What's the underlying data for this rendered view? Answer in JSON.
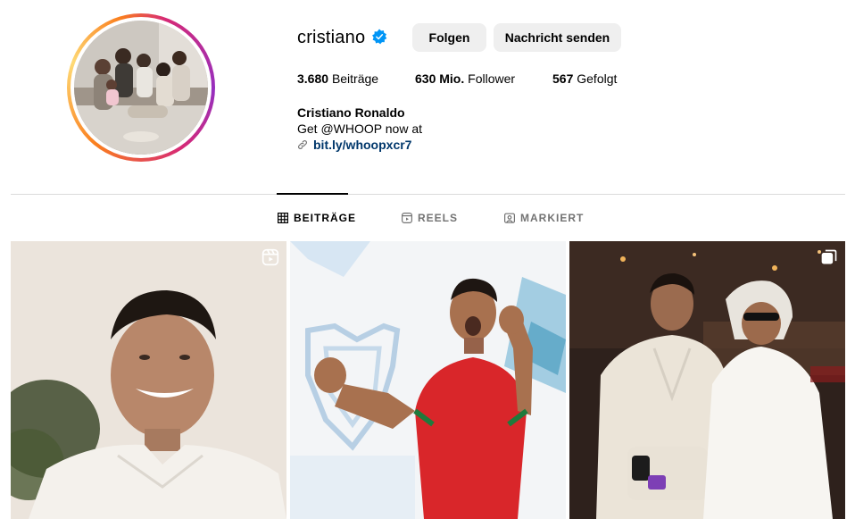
{
  "profile": {
    "username": "cristiano",
    "follow_label": "Folgen",
    "message_label": "Nachricht senden",
    "stats": {
      "posts": "3.680",
      "posts_label": "Beiträge",
      "followers": "630 Mio.",
      "followers_label": "Follower",
      "following": "567",
      "following_label": "Gefolgt"
    },
    "full_name": "Cristiano Ronaldo",
    "bio": "Get @WHOOP now at",
    "link": "bit.ly/whoopxcr7"
  },
  "tabs": [
    {
      "label": "BEITRÄGE",
      "icon": "grid-icon",
      "active": true
    },
    {
      "label": "REELS",
      "icon": "reels-icon",
      "active": false
    },
    {
      "label": "MARKIERT",
      "icon": "tagged-icon",
      "active": false
    }
  ],
  "posts": [
    {
      "badge": "reels-icon"
    },
    {
      "badge": ""
    },
    {
      "badge": "carousel-icon"
    }
  ],
  "colors": {
    "verified": "#0095f6",
    "button_bg": "#efefef",
    "link": "#00376b",
    "divider": "#dbdbdb",
    "muted": "#737373"
  }
}
